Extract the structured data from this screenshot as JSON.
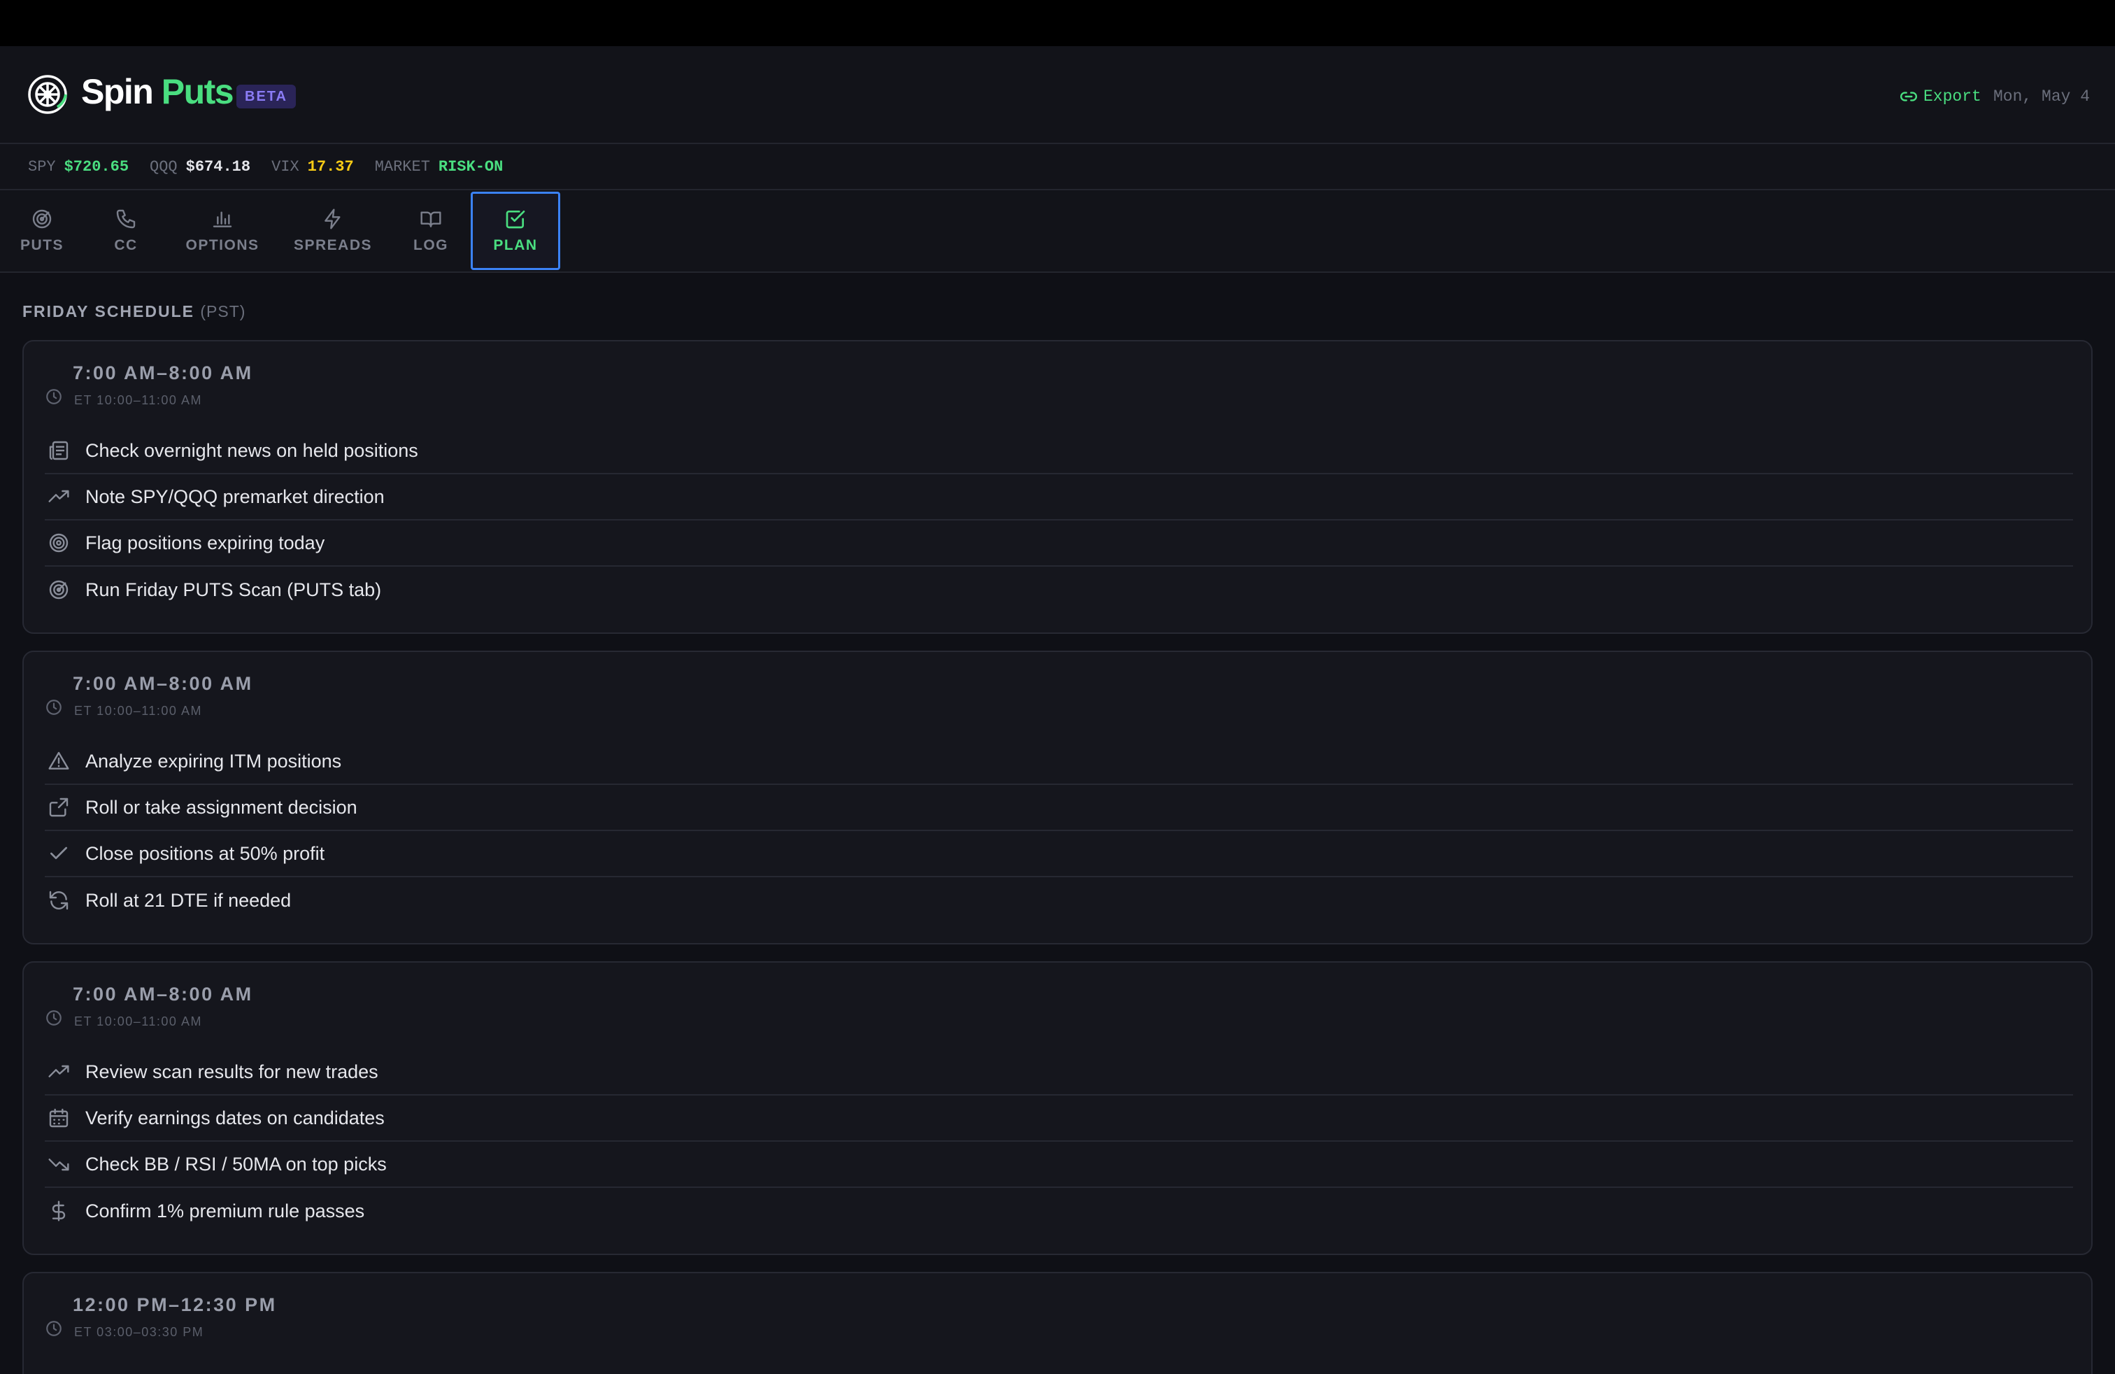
{
  "app": {
    "name_part1": "Spin",
    "name_part2": "Puts",
    "badge": "BETA",
    "export_label": "Export",
    "date": "Mon, May 4"
  },
  "colors": {
    "accent": "#4ade80",
    "background": "#0f1016",
    "beta_badge": "#8b7cf6",
    "active_tab_border": "#3b82f6"
  },
  "ticker": [
    {
      "label": "SPY",
      "value": "$720.65",
      "color": "#4ade80"
    },
    {
      "label": "QQQ",
      "value": "$674.18",
      "color": "#e6e7ec"
    },
    {
      "label": "VIX",
      "value": "17.37",
      "color": "#facc15"
    },
    {
      "label": "MARKET",
      "value": "RISK-ON",
      "color": "#4ade80"
    }
  ],
  "tabs": [
    {
      "label": "PUTS",
      "icon": "radar-icon"
    },
    {
      "label": "CC",
      "icon": "phone-icon"
    },
    {
      "label": "OPTIONS",
      "icon": "bar-chart-icon"
    },
    {
      "label": "SPREADS",
      "icon": "lightning-icon"
    },
    {
      "label": "LOG",
      "icon": "book-icon"
    },
    {
      "label": "PLAN",
      "icon": "check-square-icon",
      "active": true
    }
  ],
  "section": {
    "title": "FRIDAY SCHEDULE",
    "timezone": "(PST)"
  },
  "schedule": [
    {
      "time": "7:00 AM–8:00 AM",
      "et": "ET 10:00–11:00 AM",
      "items": [
        {
          "icon": "newspaper-icon",
          "text": "Check overnight news on held positions"
        },
        {
          "icon": "trending-up-icon",
          "text": "Note SPY/QQQ premarket direction"
        },
        {
          "icon": "target-icon",
          "text": "Flag positions expiring today"
        },
        {
          "icon": "radar-icon",
          "text": "Run Friday PUTS Scan (PUTS tab)"
        }
      ]
    },
    {
      "time": "7:00 AM–8:00 AM",
      "et": "ET 10:00–11:00 AM",
      "items": [
        {
          "icon": "warning-icon",
          "text": "Analyze expiring ITM positions"
        },
        {
          "icon": "share-icon",
          "text": "Roll or take assignment decision"
        },
        {
          "icon": "check-icon",
          "text": "Close positions at 50% profit"
        },
        {
          "icon": "refresh-icon",
          "text": "Roll at 21 DTE if needed"
        }
      ]
    },
    {
      "time": "7:00 AM–8:00 AM",
      "et": "ET 10:00–11:00 AM",
      "items": [
        {
          "icon": "trending-up-icon",
          "text": "Review scan results for new trades"
        },
        {
          "icon": "calendar-icon",
          "text": "Verify earnings dates on candidates"
        },
        {
          "icon": "trending-down-icon",
          "text": "Check BB / RSI / 50MA on top picks"
        },
        {
          "icon": "dollar-icon",
          "text": "Confirm 1% premium rule passes"
        }
      ]
    },
    {
      "time": "12:00 PM–12:30 PM",
      "et": "ET 03:00–03:30 PM",
      "items": []
    }
  ]
}
